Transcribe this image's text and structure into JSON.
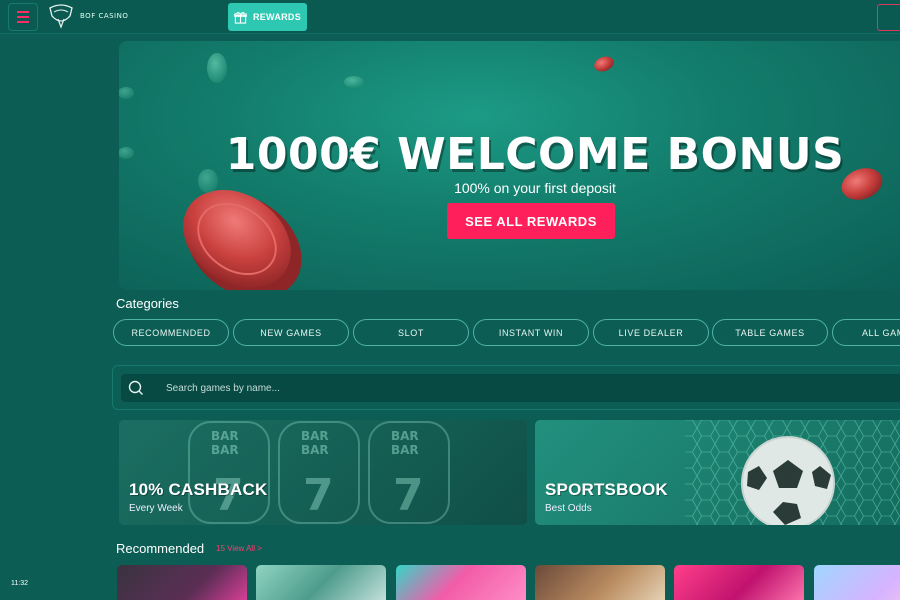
{
  "header": {
    "logo_text": "BOF CASINO",
    "rewards_label": "REWARDS"
  },
  "hero": {
    "title": "1000€ WELCOME BONUS",
    "subtitle": "100% on your first deposit",
    "cta_label": "SEE ALL REWARDS"
  },
  "categories": {
    "title": "Categories",
    "items": [
      "RECOMMENDED",
      "NEW GAMES",
      "SLOT",
      "INSTANT WIN",
      "LIVE DEALER",
      "TABLE GAMES",
      "ALL GAMES"
    ]
  },
  "search": {
    "placeholder": "Search games by name..."
  },
  "promos": [
    {
      "title": "10% CASHBACK",
      "subtitle": "Every Week"
    },
    {
      "title": "SPORTSBOOK",
      "subtitle": "Best Odds"
    }
  ],
  "recommended": {
    "title": "Recommended",
    "view_all": "15 View All  >"
  },
  "status": {
    "time": "11:32"
  },
  "colors": {
    "background": "#0c5e55",
    "accent_pink": "#ff1f5a",
    "accent_teal": "#2ec7b2"
  },
  "icons": [
    "menu-icon",
    "logo-icon",
    "gift-icon",
    "search-icon",
    "chevron-right-icon"
  ]
}
